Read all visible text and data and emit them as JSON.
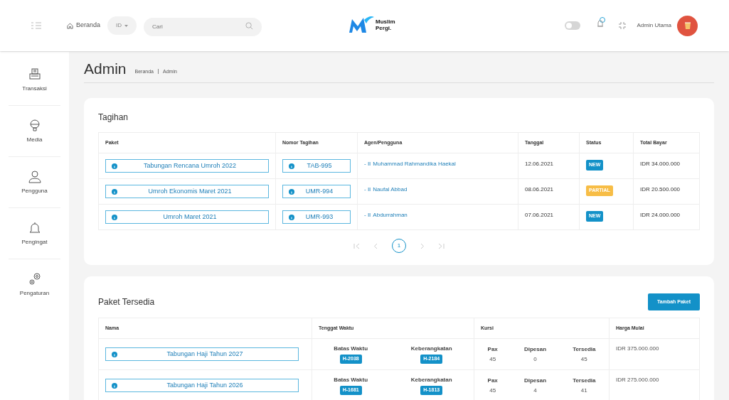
{
  "header": {
    "home_link": "Beranda",
    "language": "ID",
    "search": {
      "placeholder": "Cari"
    },
    "logo_text": [
      "Muslim",
      "Pergi."
    ],
    "dark_mode": {
      "on": false
    },
    "user_name": "Admin Utama"
  },
  "sidebar": {
    "items": [
      {
        "label": "Transaksi"
      },
      {
        "label": "Media"
      },
      {
        "label": "Pengguna"
      },
      {
        "label": "Pengingat"
      },
      {
        "label": "Pengaturan"
      }
    ]
  },
  "page": {
    "title": "Admin",
    "breadcrumb": [
      "Beranda",
      "Admin"
    ]
  },
  "tagihan": {
    "title": "Tagihan",
    "columns": [
      "Paket",
      "Nomor Tagihan",
      "Agen/Pengguna",
      "Tanggal",
      "Status",
      "Total Bayar"
    ],
    "rows": [
      {
        "paket": "Tabungan Rencana Umroh 2022",
        "nomor": "TAB-995",
        "agen_prefix": "- II",
        "agen": "Muhammad Rahmandika Haekal",
        "tanggal": "12.06.2021",
        "status": {
          "label": "NEW",
          "kind": "new"
        },
        "total": "IDR 34.000.000"
      },
      {
        "paket": "Umroh Ekonomis Maret 2021",
        "nomor": "UMR-994",
        "agen_prefix": "- II",
        "agen": "Naufal Abbad",
        "tanggal": "08.06.2021",
        "status": {
          "label": "PARTIAL",
          "kind": "partial"
        },
        "total": "IDR 20.500.000"
      },
      {
        "paket": "Umroh Maret 2021",
        "nomor": "UMR-993",
        "agen_prefix": "- II",
        "agen": "Abdurrahman",
        "tanggal": "07.06.2021",
        "status": {
          "label": "NEW",
          "kind": "new"
        },
        "total": "IDR 24.000.000"
      }
    ],
    "pagination": {
      "pages": [
        {
          "label": "1",
          "selected": true
        }
      ]
    }
  },
  "paket": {
    "title": "Paket Tersedia",
    "add_button": "Tambah Paket",
    "columns": [
      "Nama",
      "Tenggat Waktu",
      "Kursi",
      "Harga Mulai"
    ],
    "rows": [
      {
        "nama": "Tabungan Haji Tahun 2027",
        "deadlines": [
          {
            "label": "Batas Waktu",
            "value": "H-2038"
          },
          {
            "label": "Keberangkatan",
            "value": "H-2184"
          }
        ],
        "seats": [
          {
            "label": "Pax",
            "value": "45"
          },
          {
            "label": "Dipesan",
            "value": "0"
          },
          {
            "label": "Tersedia",
            "value": "45"
          }
        ],
        "harga": "IDR 375.000.000"
      },
      {
        "nama": "Tabungan Haji Tahun 2026",
        "deadlines": [
          {
            "label": "Batas Waktu",
            "value": "H-1681"
          },
          {
            "label": "Keberangkatan",
            "value": "H-1813"
          }
        ],
        "seats": [
          {
            "label": "Pax",
            "value": "45"
          },
          {
            "label": "Dipesan",
            "value": "4"
          },
          {
            "label": "Tersedia",
            "value": "41"
          }
        ],
        "harga": "IDR 275.000.000"
      }
    ]
  }
}
